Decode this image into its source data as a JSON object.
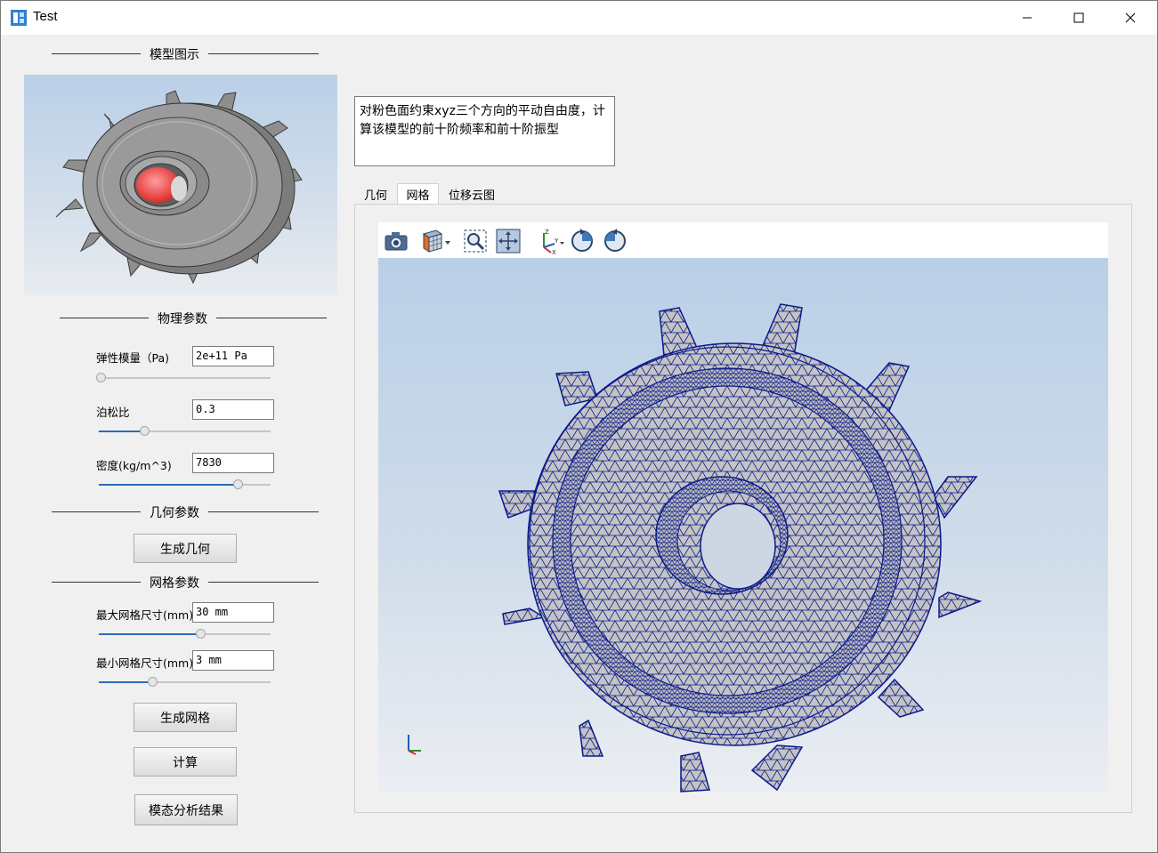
{
  "window": {
    "title": "Test"
  },
  "sections": {
    "model_preview": "模型图示",
    "physical": "物理参数",
    "geometry": "几何参数",
    "mesh": "网格参数"
  },
  "physical": {
    "elastic": {
      "label": "弹性模量（Pa)",
      "value": "2e+11 Pa",
      "slider_fraction": 0.0
    },
    "poisson": {
      "label": "泊松比",
      "value": "0.3",
      "slider_fraction": 0.25
    },
    "density": {
      "label": "密度(kg/m^3)",
      "value": "7830",
      "slider_fraction": 0.83
    }
  },
  "geometry": {
    "generate_button": "生成几何"
  },
  "mesh": {
    "max_size": {
      "label": "最大网格尺寸(mm)",
      "value": "30 mm",
      "slider_fraction": 0.6
    },
    "min_size": {
      "label": "最小网格尺寸(mm)",
      "value": "3 mm",
      "slider_fraction": 0.3
    },
    "generate_button": "生成网格"
  },
  "actions": {
    "compute": "计算",
    "modal_results": "模态分析结果"
  },
  "description": "对粉色面约束xyz三个方向的平动自由度，计算该模型的前十阶频率和前十阶振型",
  "tabs": [
    "几何",
    "网格",
    "位移云图"
  ],
  "active_tab": "网格",
  "toolbar": {
    "icons": [
      "camera-icon",
      "view-cube-icon",
      "zoom-box-icon",
      "fit-all-icon",
      "axes-icon",
      "rotate-cw-icon",
      "rotate-ccw-icon"
    ]
  },
  "colors": {
    "accent": "#2a6cb8",
    "mesh_line": "#0a1a8c",
    "mesh_face": "#c4c4c4",
    "constraint_face": "#f05a5a"
  }
}
